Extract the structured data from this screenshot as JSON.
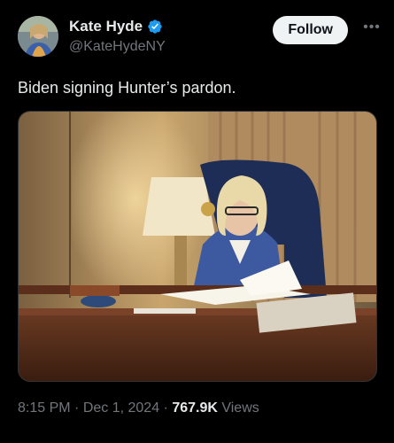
{
  "author": {
    "display_name": "Kate Hyde",
    "handle": "@KateHydeNY",
    "verified": true,
    "avatar_icon": "profile-photo"
  },
  "follow_label": "Follow",
  "more_icon": "more-horizontal-icon",
  "tweet_text": "Biden signing Hunter’s pardon.",
  "media": {
    "description_icon": "photo"
  },
  "meta": {
    "time": "8:15 PM",
    "separator1": " · ",
    "date": "Dec 1, 2024",
    "separator2": " · ",
    "views_count": "767.9K",
    "views_label": " Views"
  },
  "colors": {
    "background": "#000000",
    "text": "#e7e9ea",
    "secondary": "#71767b",
    "verified": "#1d9bf0",
    "follow_bg": "#eff3f4"
  }
}
